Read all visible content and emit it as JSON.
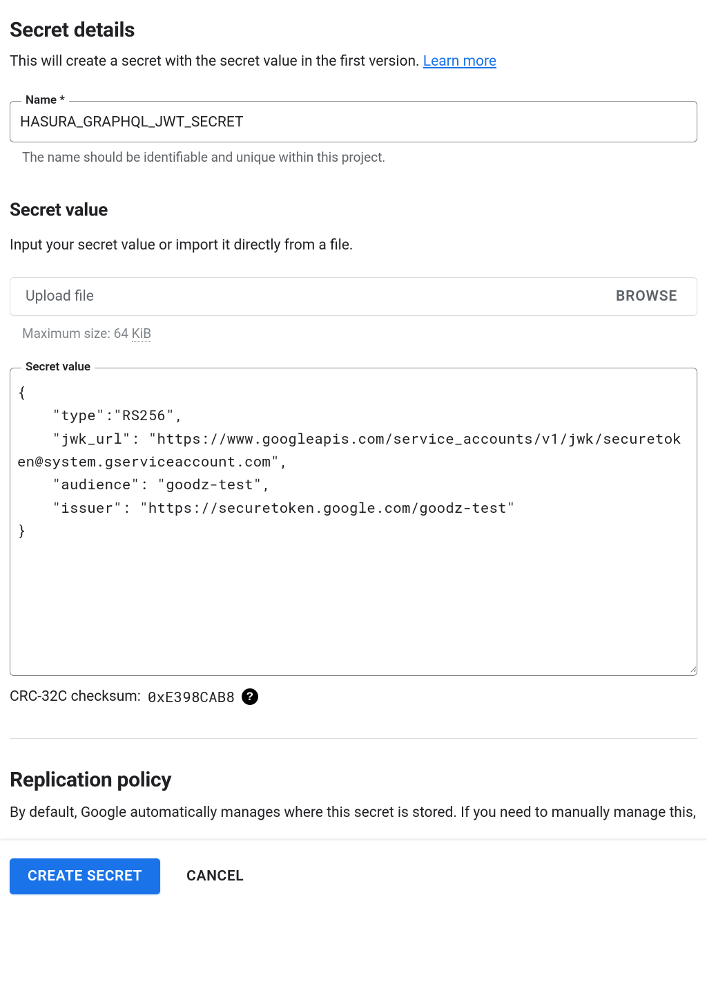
{
  "secret_details": {
    "title": "Secret details",
    "description_prefix": "This will create a secret with the secret value in the first version. ",
    "learn_more": "Learn more",
    "name_label": "Name *",
    "name_value": "HASURA_GRAPHQL_JWT_SECRET",
    "name_helper": "The name should be identifiable and unique within this project."
  },
  "secret_value": {
    "title": "Secret value",
    "description": "Input your secret value or import it directly from a file.",
    "upload_placeholder": "Upload file",
    "browse_label": "BROWSE",
    "upload_helper_prefix": "Maximum size: 64 ",
    "upload_helper_unit": "KiB",
    "textarea_label": "Secret value",
    "textarea_value": "{\n    \"type\":\"RS256\",\n    \"jwk_url\": \"https://www.googleapis.com/service_accounts/v1/jwk/securetoken@system.gserviceaccount.com\",\n    \"audience\": \"goodz-test\",\n    \"issuer\": \"https://securetoken.google.com/goodz-test\"\n}",
    "checksum_label": "CRC-32C checksum: ",
    "checksum_value": "0xE398CAB8"
  },
  "replication": {
    "title": "Replication policy",
    "description": "By default, Google automatically manages where this secret is stored. If you need to manually manage this, you can customize the locations by checking the box below. All"
  },
  "footer": {
    "create_label": "CREATE SECRET",
    "cancel_label": "CANCEL"
  }
}
